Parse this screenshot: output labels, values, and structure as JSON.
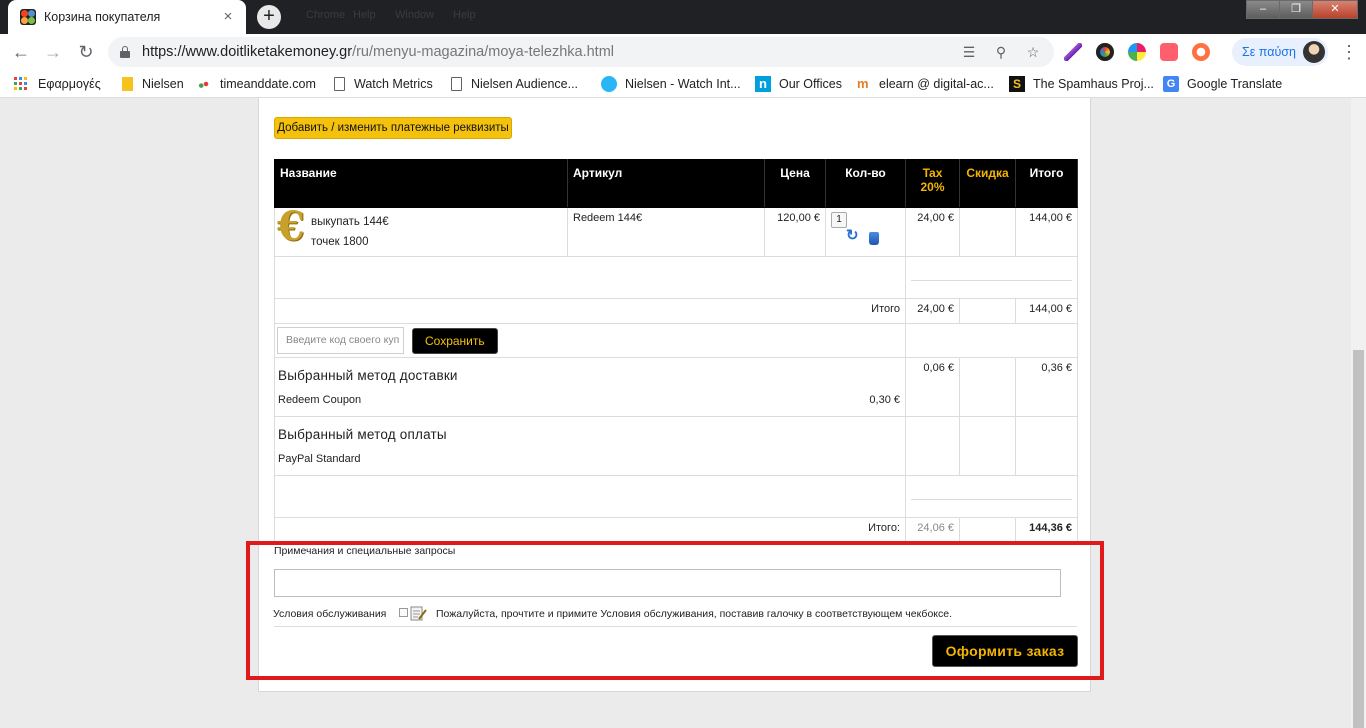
{
  "browser": {
    "tab_title": "Корзина покупателя",
    "tab_close": "×",
    "new_tab": "+",
    "ghost_menu": [
      "Chrome",
      "Help",
      "Window",
      "Help"
    ],
    "win_buttons": [
      "–",
      "❐",
      "✕"
    ],
    "url_domain": "https://www.doitliketakemoney.gr",
    "url_path": "/ru/menyu-magazina/moya-telezhka.html",
    "profile_label": "Σε παύση",
    "menu_icon": "⋮"
  },
  "bookmarks": [
    {
      "label": "Εφαρμογές",
      "icon": "apps-icon"
    },
    {
      "label": "Nielsen",
      "icon": "bookmark-nielsen-icon"
    },
    {
      "label": "timeanddate.com",
      "icon": "timeanddate-icon"
    },
    {
      "label": "Watch Metrics",
      "icon": "document-icon"
    },
    {
      "label": "Nielsen Audience...",
      "icon": "document-icon"
    },
    {
      "label": "Nielsen - Watch Int...",
      "icon": "nielsen-watch-icon"
    },
    {
      "label": "Our Offices",
      "icon": "our-offices-icon"
    },
    {
      "label": "elearn @ digital-ac...",
      "icon": "elearn-icon"
    },
    {
      "label": "The Spamhaus Proj...",
      "icon": "spamhaus-icon"
    },
    {
      "label": "Google Translate",
      "icon": "google-translate-icon"
    }
  ],
  "cart": {
    "billing_button": "Добавить / изменить платежные реквизиты",
    "headers": {
      "name": "Название",
      "sku": "Артикул",
      "price": "Цена",
      "qty": "Кол-во",
      "tax_line1": "Tax",
      "tax_line2": "20%",
      "discount": "Скидка",
      "total": "Итого"
    },
    "item": {
      "name_line1": "выкупать 144€",
      "name_line2": "точек 1800",
      "sku": "Redeem 144€",
      "price": "120,00 €",
      "qty": "1",
      "tax": "24,00 €",
      "total": "144,00 €",
      "icon": "euro-coin-icon"
    },
    "subtotal": {
      "label": "Итого",
      "tax": "24,00 €",
      "total": "144,00 €"
    },
    "coupon": {
      "placeholder": "Введите код своего куп",
      "save_label": "Сохранить"
    },
    "shipping": {
      "title": "Выбранный метод доставки",
      "method": "Redeem Coupon",
      "price": "0,30 €",
      "tax": "0,06 €",
      "total": "0,36 €"
    },
    "payment": {
      "title": "Выбранный метод оплаты",
      "method": "PayPal Standard"
    },
    "grand_total": {
      "label": "Итого:",
      "tax": "24,06 €",
      "total": "144,36 €"
    },
    "notes_label": "Примечания и специальные запросы",
    "tos_label": "Условия обслуживания",
    "tos_text": "Пожалуйста, прочтите и примите Условия обслуживания, поставив галочку в соответствующем чекбоксе.",
    "checkout_label": "Оформить заказ"
  },
  "colors": {
    "accent_yellow": "#f4c20d",
    "highlight_red": "#e0191b",
    "header_black": "#000000"
  }
}
